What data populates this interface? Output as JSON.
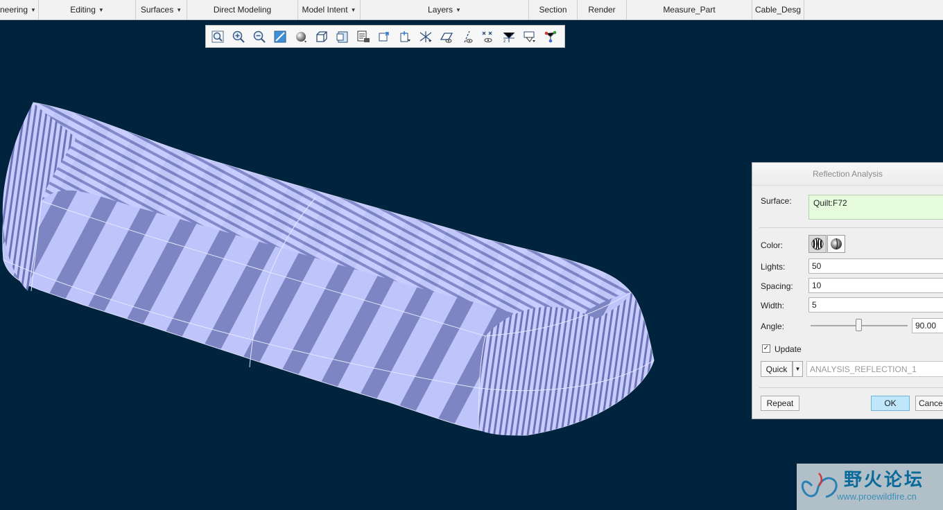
{
  "ribbon": {
    "groups": [
      {
        "label": "neering",
        "dropdown": true
      },
      {
        "label": "Editing",
        "dropdown": true
      },
      {
        "label": "Surfaces",
        "dropdown": true
      },
      {
        "label": "Direct Modeling",
        "dropdown": false
      },
      {
        "label": "Model Intent",
        "dropdown": true
      },
      {
        "label": "Layers",
        "dropdown": true
      },
      {
        "label": "Section",
        "dropdown": false
      },
      {
        "label": "Render",
        "dropdown": false
      },
      {
        "label": "Measure_Part",
        "dropdown": false
      },
      {
        "label": "Cable_Desg",
        "dropdown": false
      }
    ]
  },
  "graphics_toolbar": {
    "icons": [
      "refit-icon",
      "zoom-in-icon",
      "zoom-out-icon",
      "repaint-icon",
      "display-style-icon",
      "saved-orientations-icon",
      "view-manager-icon",
      "perspective-view-icon",
      "spin-center-icon",
      "annotation-display-icon",
      "datum-display-icon",
      "plane-display-icon",
      "axis-display-icon",
      "point-display-icon",
      "csys-display-icon",
      "filter-icon",
      "network-icon"
    ]
  },
  "dialog": {
    "title": "Reflection Analysis",
    "surface_label": "Surface:",
    "surface_value": "Quilt:F72",
    "color_label": "Color:",
    "lights_label": "Lights:",
    "lights_value": "50",
    "spacing_label": "Spacing:",
    "spacing_value": "10",
    "width_label": "Width:",
    "width_value": "5",
    "angle_label": "Angle:",
    "angle_value": "90.00",
    "update_label": "Update",
    "update_checked": true,
    "quick_label": "Quick",
    "analysis_name": "ANALYSIS_REFLECTION_1",
    "repeat_label": "Repeat",
    "ok_label": "OK",
    "cancel_label": "Cancel"
  },
  "watermark": {
    "title": "野火论坛",
    "url": "www.proewildfire.cn"
  },
  "colors": {
    "background": "#00243d",
    "model_light": "#c3c8ff",
    "model_dark": "#6f77b8",
    "ok_button": "#bfe6fb",
    "surface_box": "#e6fbdc"
  }
}
